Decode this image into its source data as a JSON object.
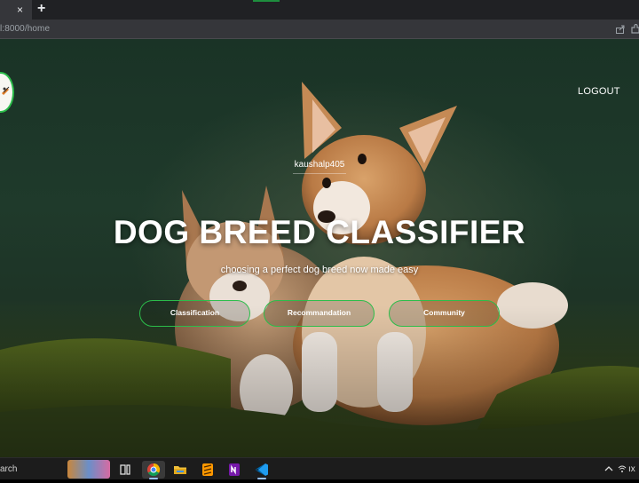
{
  "browser": {
    "tab_close_glyph": "×",
    "new_tab_glyph": "+",
    "url": "l:8000/home",
    "icons": [
      "close-icon",
      "plus-icon",
      "share-icon",
      "extension-icon"
    ]
  },
  "page": {
    "logout_label": "LOGOUT",
    "username": "kaushalp405",
    "title": "DOG BREED CLASSIFIER",
    "subtitle": "choosing a perfect dog breed now made easy",
    "buttons": [
      {
        "label": "Classification"
      },
      {
        "label": "Recommandation"
      },
      {
        "label": "Community"
      }
    ],
    "accent_color": "#2bbd4a"
  },
  "taskbar": {
    "search_label": "arch",
    "tray_text": "ıx",
    "icons": [
      "weather-widget-icon",
      "task-view-icon",
      "chrome-icon",
      "file-explorer-icon",
      "sublime-text-icon",
      "onenote-icon",
      "vscode-icon",
      "chevron-up-icon",
      "wifi-icon"
    ]
  }
}
